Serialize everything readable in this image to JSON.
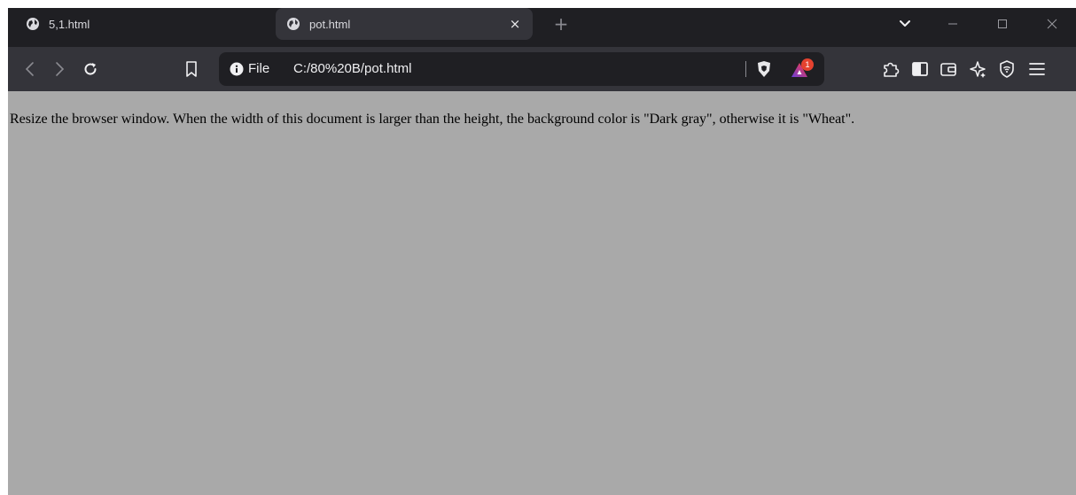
{
  "browser": {
    "tabs": [
      {
        "title": "5,1.html",
        "active": false
      },
      {
        "title": "pot.html",
        "active": true
      }
    ],
    "new_tab_label": "+",
    "close_tab_label": "×",
    "address": {
      "scheme_label": "File",
      "url": "C:/80%20B/pot.html"
    },
    "rewards_badge": "1",
    "icons": {
      "back": "chevron-left-icon",
      "forward": "chevron-right-icon",
      "reload": "reload-icon",
      "bookmark": "bookmark-icon",
      "info": "info-icon",
      "brave_shield": "lion-shield-icon",
      "brave_rewards": "rewards-triangle-icon",
      "extensions": "puzzle-icon",
      "sidebar": "sidebar-icon",
      "wallet": "wallet-icon",
      "leo": "leo-ai-icon",
      "vpn": "vpn-shield-icon",
      "menu": "hamburger-menu-icon",
      "tab_search": "chevron-down-icon",
      "minimize": "minimize-icon",
      "maximize": "maximize-icon",
      "close": "close-icon"
    },
    "colors": {
      "tabstrip_bg": "#1f1f23",
      "toolbar_bg": "#34343a",
      "page_bg": "#a9a9a9",
      "badge": "#e5422f"
    }
  },
  "page": {
    "text": "Resize the browser window. When the width of this document is larger than the height, the background color is \"Dark gray\", otherwise it is \"Wheat\"."
  }
}
